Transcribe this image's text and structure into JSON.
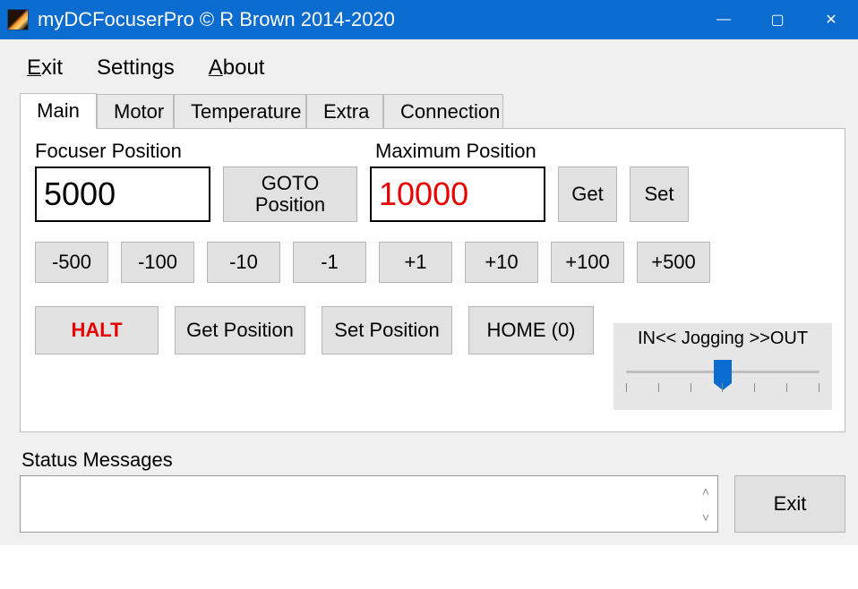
{
  "window": {
    "title": "myDCFocuserPro © R Brown 2014-2020",
    "minimize": "—",
    "maximize": "▢",
    "close": "✕"
  },
  "menu": {
    "exit": "Exit",
    "settings": "Settings",
    "about": "About"
  },
  "tabs": {
    "main": "Main",
    "motor": "Motor",
    "temperature": "Temperature",
    "extra": "Extra",
    "connection": "Connection",
    "active": "main"
  },
  "main_tab": {
    "focuser_label": "Focuser Position",
    "focuser_value": "5000",
    "maximum_label": "Maximum Position",
    "maximum_value": "10000",
    "goto_label": "GOTO Position",
    "get_label": "Get",
    "set_label": "Set",
    "steps": [
      "-500",
      "-100",
      "-10",
      "-1",
      "+1",
      "+10",
      "+100",
      "+500"
    ],
    "halt_label": "HALT",
    "get_position_label": "Get Position",
    "set_position_label": "Set Position",
    "home_label": "HOME (0)",
    "jogging_label": "IN<< Jogging >>OUT"
  },
  "status": {
    "label": "Status Messages",
    "text": "",
    "exit_label": "Exit"
  },
  "colors": {
    "titlebar": "#0a6cce",
    "danger": "#e60000",
    "button_bg": "#e1e1e1"
  }
}
